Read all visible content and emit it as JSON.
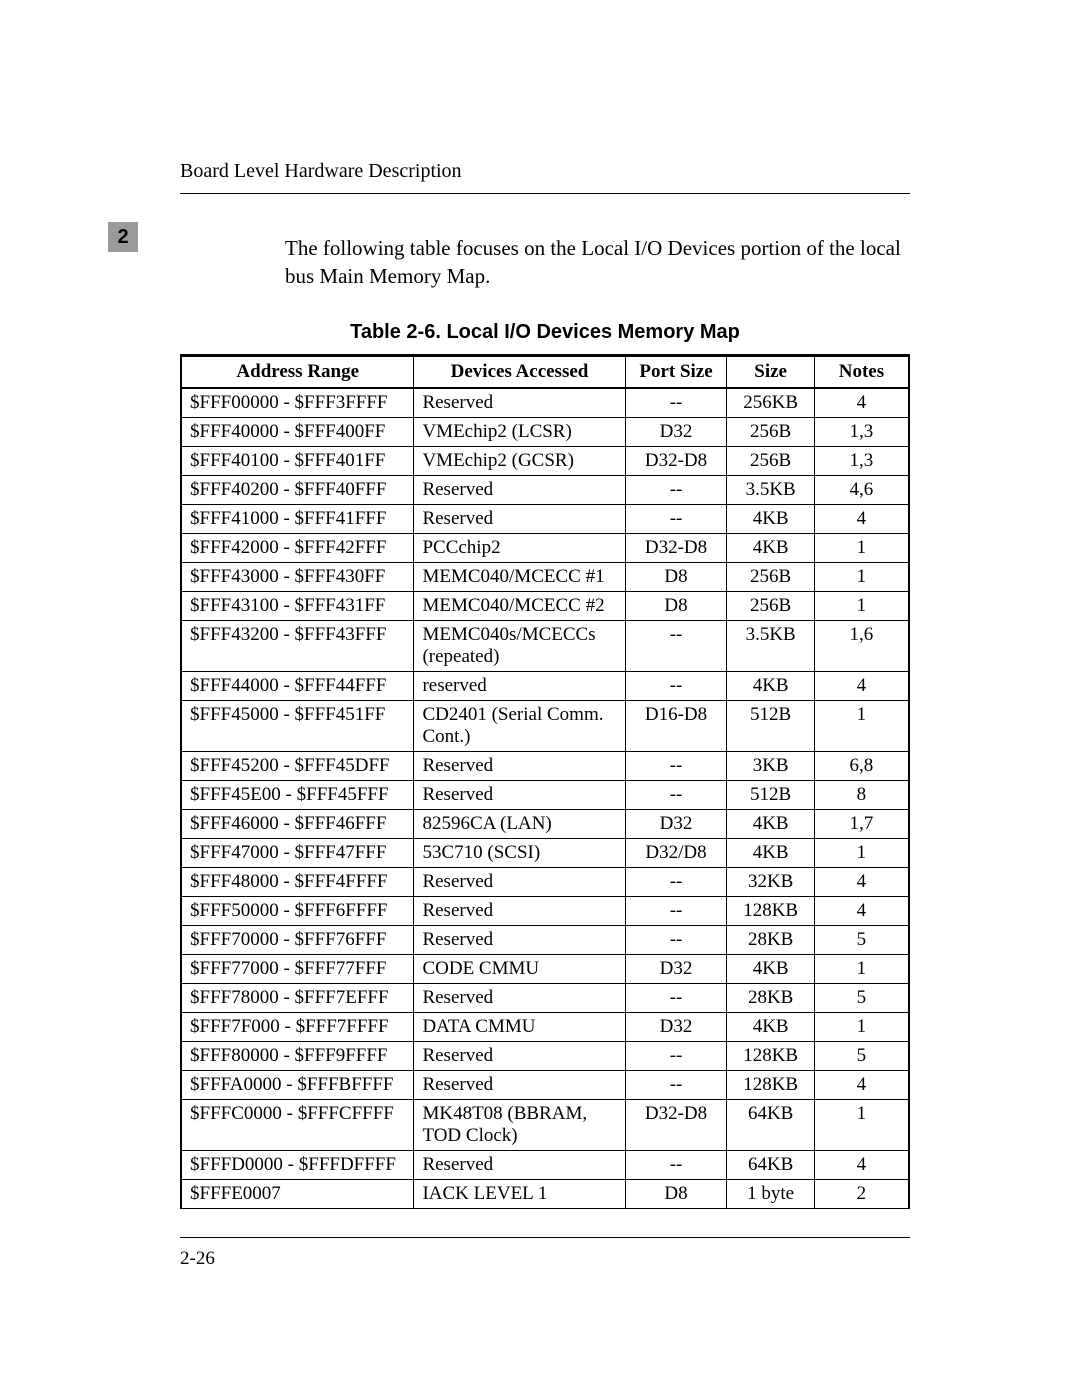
{
  "header": {
    "running_title": "Board Level Hardware Description",
    "section_marker": "2"
  },
  "intro": "The following table focuses on the Local I/O Devices portion of the local bus Main Memory Map.",
  "table": {
    "caption": "Table 2-6.  Local I/O Devices Memory Map",
    "columns": {
      "address": "Address Range",
      "device": "Devices Accessed",
      "port": "Port Size",
      "size": "Size",
      "notes": "Notes"
    },
    "rows": [
      {
        "address": "$FFF00000 - $FFF3FFFF",
        "device": "Reserved",
        "port": "--",
        "size": "256KB",
        "notes": "4"
      },
      {
        "address": "$FFF40000 - $FFF400FF",
        "device": "VMEchip2 (LCSR)",
        "port": "D32",
        "size": "256B",
        "notes": "1,3"
      },
      {
        "address": "$FFF40100 - $FFF401FF",
        "device": "VMEchip2 (GCSR)",
        "port": "D32-D8",
        "size": "256B",
        "notes": "1,3"
      },
      {
        "address": "$FFF40200 - $FFF40FFF",
        "device": "Reserved",
        "port": "--",
        "size": "3.5KB",
        "notes": "4,6"
      },
      {
        "address": "$FFF41000 - $FFF41FFF",
        "device": "Reserved",
        "port": "--",
        "size": "4KB",
        "notes": "4"
      },
      {
        "address": "$FFF42000 - $FFF42FFF",
        "device": "PCCchip2",
        "port": "D32-D8",
        "size": "4KB",
        "notes": "1"
      },
      {
        "address": "$FFF43000 - $FFF430FF",
        "device": "MEMC040/MCECC #1",
        "port": "D8",
        "size": "256B",
        "notes": "1"
      },
      {
        "address": "$FFF43100 - $FFF431FF",
        "device": "MEMC040/MCECC #2",
        "port": "D8",
        "size": "256B",
        "notes": "1"
      },
      {
        "address": "$FFF43200 - $FFF43FFF",
        "device": "MEMC040s/MCECCs (repeated)",
        "port": "--",
        "size": "3.5KB",
        "notes": "1,6"
      },
      {
        "address": "$FFF44000 - $FFF44FFF",
        "device": "reserved",
        "port": "--",
        "size": "4KB",
        "notes": "4"
      },
      {
        "address": "$FFF45000 - $FFF451FF",
        "device": "CD2401 (Serial Comm. Cont.)",
        "port": "D16-D8",
        "size": "512B",
        "notes": "1"
      },
      {
        "address": "$FFF45200 - $FFF45DFF",
        "device": "Reserved",
        "port": "--",
        "size": "3KB",
        "notes": "6,8"
      },
      {
        "address": "$FFF45E00 - $FFF45FFF",
        "device": "Reserved",
        "port": "--",
        "size": "512B",
        "notes": "8"
      },
      {
        "address": "$FFF46000 - $FFF46FFF",
        "device": "82596CA (LAN)",
        "port": "D32",
        "size": "4KB",
        "notes": "1,7"
      },
      {
        "address": "$FFF47000 - $FFF47FFF",
        "device": "53C710 (SCSI)",
        "port": "D32/D8",
        "size": "4KB",
        "notes": "1"
      },
      {
        "address": "$FFF48000 - $FFF4FFFF",
        "device": "Reserved",
        "port": "--",
        "size": "32KB",
        "notes": "4"
      },
      {
        "address": "$FFF50000 - $FFF6FFFF",
        "device": "Reserved",
        "port": "--",
        "size": "128KB",
        "notes": "4"
      },
      {
        "address": "$FFF70000 - $FFF76FFF",
        "device": "Reserved",
        "port": "--",
        "size": "28KB",
        "notes": "5"
      },
      {
        "address": "$FFF77000 - $FFF77FFF",
        "device": "CODE CMMU",
        "port": "D32",
        "size": "4KB",
        "notes": "1"
      },
      {
        "address": "$FFF78000 - $FFF7EFFF",
        "device": "Reserved",
        "port": "--",
        "size": "28KB",
        "notes": "5"
      },
      {
        "address": "$FFF7F000 - $FFF7FFFF",
        "device": "DATA CMMU",
        "port": "D32",
        "size": "4KB",
        "notes": "1"
      },
      {
        "address": "$FFF80000 - $FFF9FFFF",
        "device": "Reserved",
        "port": "--",
        "size": "128KB",
        "notes": "5"
      },
      {
        "address": "$FFFA0000 - $FFFBFFFF",
        "device": "Reserved",
        "port": "--",
        "size": "128KB",
        "notes": "4"
      },
      {
        "address": "$FFFC0000 - $FFFCFFFF",
        "device": "MK48T08 (BBRAM, TOD Clock)",
        "port": "D32-D8",
        "size": "64KB",
        "notes": "1"
      },
      {
        "address": "$FFFD0000 - $FFFDFFFF",
        "device": "Reserved",
        "port": "--",
        "size": "64KB",
        "notes": "4"
      },
      {
        "address": "$FFFE0007",
        "device": "IACK LEVEL 1",
        "port": "D8",
        "size": "1 byte",
        "notes": "2"
      }
    ]
  },
  "footer": {
    "page_number": "2-26"
  }
}
